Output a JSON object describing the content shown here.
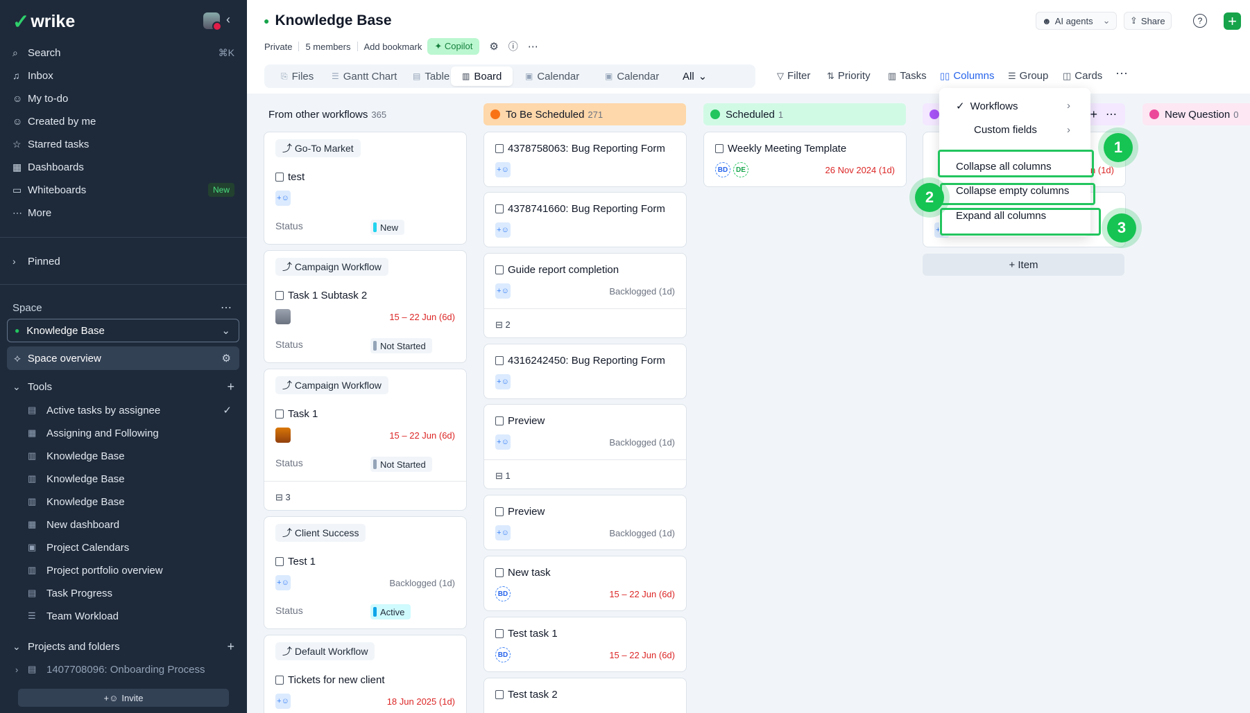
{
  "app": {
    "logo": "wrike"
  },
  "sidebar": {
    "nav": [
      {
        "label": "Search",
        "shortcut": "⌘K",
        "icon": "search-icon"
      },
      {
        "label": "Inbox",
        "icon": "bell-icon"
      },
      {
        "label": "My to-do",
        "icon": "user-check-icon"
      },
      {
        "label": "Created by me",
        "icon": "user-plus-icon"
      },
      {
        "label": "Starred tasks",
        "icon": "star-icon"
      },
      {
        "label": "Dashboards",
        "icon": "dashboard-icon"
      },
      {
        "label": "Whiteboards",
        "badge": "New",
        "icon": "whiteboard-icon"
      },
      {
        "label": "More",
        "icon": "more-icon"
      }
    ],
    "pinned": "Pinned",
    "space_label": "Space",
    "space_name": "Knowledge Base",
    "space_overview": "Space overview",
    "tools_label": "Tools",
    "tools": [
      "Active tasks by assignee",
      "Assigning and Following",
      "Knowledge Base",
      "Knowledge Base",
      "Knowledge Base",
      "New dashboard",
      "Project Calendars",
      "Project portfolio overview",
      "Task Progress",
      "Team Workload"
    ],
    "projects_label": "Projects and folders",
    "project_item": "1407708096: Onboarding Process",
    "invite": "Invite"
  },
  "header": {
    "title": "Knowledge Base",
    "meta": [
      "Private",
      "5 members",
      "Add bookmark"
    ],
    "copilot": "Copilot",
    "ai_agents": "AI agents",
    "share": "Share"
  },
  "tabs": [
    "Files",
    "Gantt Chart",
    "Table",
    "Board",
    "Calendar",
    "Calendar",
    "All"
  ],
  "active_tab": "Board",
  "toolbar": [
    "Filter",
    "Priority",
    "Tasks",
    "Columns",
    "Group",
    "Cards"
  ],
  "columns": [
    {
      "title": "From other workflows",
      "count": "365"
    },
    {
      "title": "To Be Scheduled",
      "count": "271",
      "color": "#f97316"
    },
    {
      "title": "Scheduled",
      "count": "1",
      "color": "#22c55e"
    },
    {
      "title": "New Question",
      "count": "0",
      "color": "#ec4899"
    }
  ],
  "col1_cards": [
    {
      "workflow": "Go-To Market",
      "title": "test",
      "status_label": "Status",
      "status": "New",
      "status_color": "#22d3ee"
    },
    {
      "workflow": "Campaign Workflow",
      "title": "Task 1 Subtask 2",
      "date": "15 – 22 Jun (6d)",
      "status_label": "Status",
      "status": "Not Started",
      "status_color": "#94a3b8"
    },
    {
      "workflow": "Campaign Workflow",
      "title": "Task 1",
      "date": "15 – 22 Jun (6d)",
      "status_label": "Status",
      "status": "Not Started",
      "status_color": "#94a3b8",
      "subtasks": "3"
    },
    {
      "workflow": "Client Success",
      "title": "Test 1",
      "back": "Backlogged (1d)",
      "status_label": "Status",
      "status": "Active",
      "status_color": "#0ea5e9"
    },
    {
      "workflow": "Default Workflow",
      "title": "Tickets for new client",
      "date": "18 Jun 2025 (1d)"
    }
  ],
  "col2_cards": [
    {
      "title": "4378758063: Bug Reporting Form"
    },
    {
      "title": "4378741660: Bug Reporting Form"
    },
    {
      "title": "Guide report completion",
      "back": "Backlogged (1d)",
      "subtasks": "2"
    },
    {
      "title": "4316242450: Bug Reporting Form"
    },
    {
      "title": "Preview",
      "back": "Backlogged (1d)",
      "subtasks": "1"
    },
    {
      "title": "Preview",
      "back": "Backlogged (1d)"
    },
    {
      "title": "New task",
      "assignee": "BD",
      "date": "15 – 22 Jun (6d)"
    },
    {
      "title": "Test task 1",
      "assignee": "BD",
      "date": "15 – 22 Jun (6d)"
    },
    {
      "title": "Test task 2"
    }
  ],
  "col3_cards": [
    {
      "title": "Weekly Meeting Template",
      "assignees": [
        "BD",
        "DE"
      ],
      "date": "26 Nov 2024 (1d)"
    }
  ],
  "col4_partial": {
    "date": "n (1d)",
    "add_item": "+ Item"
  },
  "columns_menu": {
    "items": [
      "Workflows",
      "Custom fields",
      "Collapse all columns",
      "Collapse empty columns",
      "Expand all columns"
    ]
  },
  "annotations": [
    "1",
    "2",
    "3"
  ]
}
